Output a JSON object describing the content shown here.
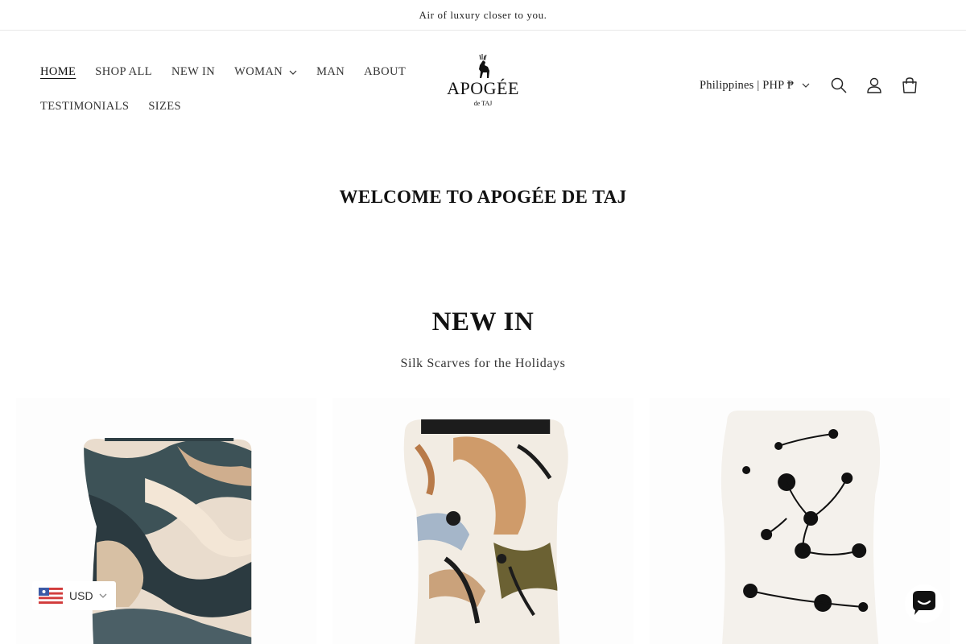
{
  "announcement": {
    "text": "Air of luxury closer to you."
  },
  "nav": {
    "items": [
      {
        "label": "HOME",
        "active": true
      },
      {
        "label": "SHOP ALL"
      },
      {
        "label": "NEW IN"
      },
      {
        "label": "WOMAN",
        "has_dropdown": true
      },
      {
        "label": "MAN"
      },
      {
        "label": "ABOUT"
      },
      {
        "label": "TESTIMONIALS"
      },
      {
        "label": "SIZES"
      }
    ]
  },
  "logo": {
    "brand": "APOGÉE",
    "tagline": "de TAJ",
    "icon": "deer-icon"
  },
  "utils": {
    "country_label": "Philippines | PHP ₱",
    "icons": [
      "search-icon",
      "account-icon",
      "cart-icon"
    ]
  },
  "hero": {
    "welcome": "WELCOME TO APOGÉE DE TAJ"
  },
  "new_in": {
    "title": "NEW IN",
    "subtitle": "Silk Scarves for the Holidays"
  },
  "currency": {
    "code": "USD",
    "icon": "us-flag-icon"
  },
  "chat": {
    "icon": "chat-icon"
  },
  "colors": {
    "text": "#121212",
    "border": "#e8e8e8",
    "background": "#ffffff"
  }
}
